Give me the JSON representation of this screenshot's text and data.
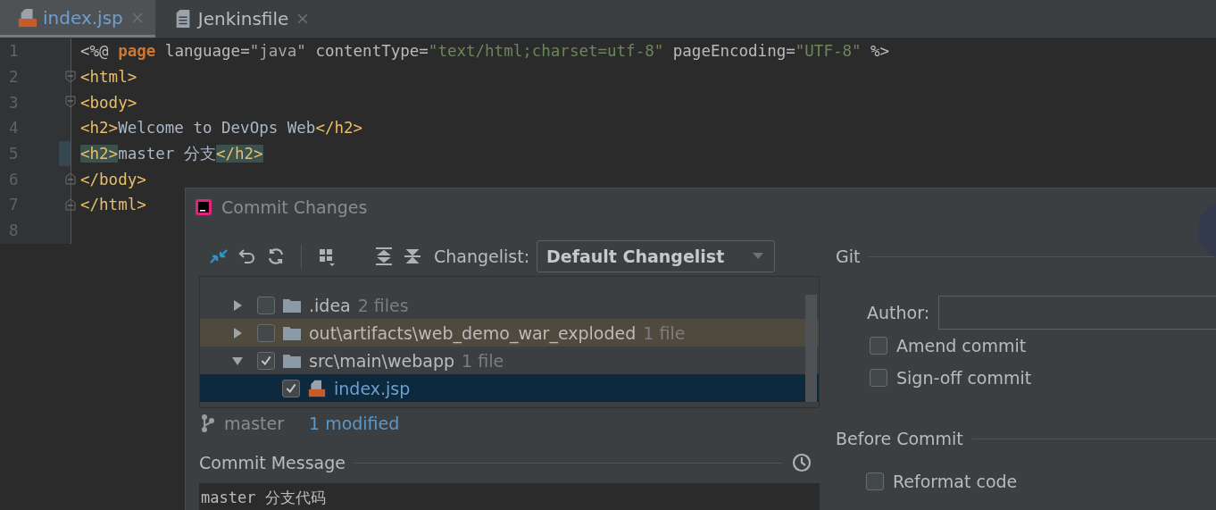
{
  "tabs": [
    {
      "label": "index.jsp",
      "kind": "jsp",
      "selected": true
    },
    {
      "label": "Jenkinsfile",
      "kind": "text",
      "selected": false
    }
  ],
  "editor": {
    "lines": [
      {
        "number": "1",
        "tokens": [
          {
            "text": "<%@ ",
            "kind": "plain"
          },
          {
            "text": "page",
            "kind": "keyword"
          },
          {
            "text": " language=",
            "kind": "attr"
          },
          {
            "text": "\"java\"",
            "kind": "quoted"
          },
          {
            "text": " contentType=",
            "kind": "attr"
          },
          {
            "text": "\"text/html;charset=utf-8\"",
            "kind": "string"
          },
          {
            "text": " pageEncoding=",
            "kind": "attr"
          },
          {
            "text": "\"UTF-8\"",
            "kind": "string"
          },
          {
            "text": " %>",
            "kind": "plain"
          }
        ]
      },
      {
        "number": "2",
        "fold_start": true,
        "tokens": [
          {
            "text": "<html>",
            "kind": "tag"
          }
        ]
      },
      {
        "number": "3",
        "fold_start": true,
        "tokens": [
          {
            "text": "<body>",
            "kind": "tag"
          }
        ]
      },
      {
        "number": "4",
        "tokens": [
          {
            "text": "<h2>",
            "kind": "tag"
          },
          {
            "text": "Welcome to DevOps Web",
            "kind": "text"
          },
          {
            "text": "</h2>",
            "kind": "tag"
          }
        ]
      },
      {
        "number": "5",
        "changed": true,
        "tokens": [
          {
            "text": "<h2>",
            "kind": "tag",
            "matched": true
          },
          {
            "text": "master 分支",
            "kind": "text"
          },
          {
            "text": "</h2>",
            "kind": "tag",
            "matched": true
          }
        ]
      },
      {
        "number": "6",
        "fold_end": true,
        "tokens": [
          {
            "text": "</body>",
            "kind": "tag"
          }
        ]
      },
      {
        "number": "7",
        "fold_end": true,
        "tokens": [
          {
            "text": "</html>",
            "kind": "tag"
          }
        ]
      },
      {
        "number": "8"
      }
    ]
  },
  "dialog": {
    "title": "Commit Changes",
    "changelist_label": "Changelist:",
    "changelist": "Default Changelist",
    "tree": [
      {
        "name": ".idea",
        "count": "2 files",
        "kind": "folder",
        "checked": false,
        "expanded": false,
        "selected": false,
        "hover": false
      },
      {
        "name": "out\\artifacts\\web_demo_war_exploded",
        "count": "1 file",
        "kind": "folder",
        "checked": false,
        "expanded": false,
        "selected": false,
        "hover": true
      },
      {
        "name": "src\\main\\webapp",
        "count": "1 file",
        "kind": "folder",
        "checked": true,
        "expanded": true,
        "selected": false,
        "hover": false,
        "children": [
          {
            "name": "index.jsp",
            "kind": "jsp",
            "checked": true,
            "selected": true,
            "hover": false
          }
        ]
      }
    ],
    "branch": "master",
    "modified": "1 modified",
    "message_label": "Commit Message",
    "message": "master 分支代码",
    "git_header": "Git",
    "author_label": "Author:",
    "options": [
      {
        "label": "Amend commit",
        "checked": false
      },
      {
        "label": "Sign-off commit",
        "checked": false
      }
    ],
    "before_header": "Before Commit",
    "before_options": [
      {
        "label": "Reformat code",
        "checked": false
      }
    ]
  }
}
